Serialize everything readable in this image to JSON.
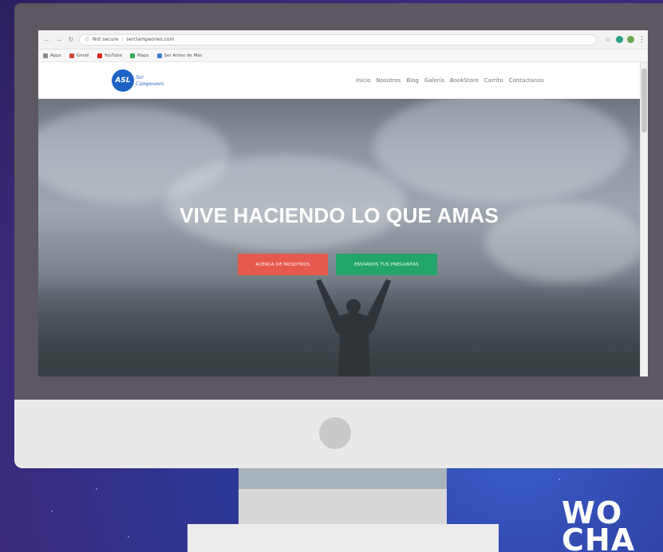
{
  "browser": {
    "url_security": "Not secure",
    "url": "serclampeones.com",
    "bookmarks": [
      "Apps",
      "Gmail",
      "YouTube",
      "Maps",
      "Ser Antes de Más"
    ]
  },
  "site": {
    "logo_mark": "ASL",
    "logo_line1": "Ser",
    "logo_line2": "Campeones",
    "nav": [
      "Inicio",
      "Nosotros",
      "Blog",
      "Galería",
      "BookStore",
      "Carrito",
      "Contactanos"
    ]
  },
  "hero": {
    "headline": "VIVE HACIENDO LO QUE AMAS",
    "button_primary": "ACERCA DE NOSOTROS",
    "button_secondary": "ENVIANOS TUS PREGUNTAS"
  },
  "overlay_text": {
    "line1": "WO",
    "line2": "CHA"
  },
  "colors": {
    "brand_blue": "#1f63c6",
    "button_red": "#e5594e",
    "button_green": "#22a56a"
  }
}
